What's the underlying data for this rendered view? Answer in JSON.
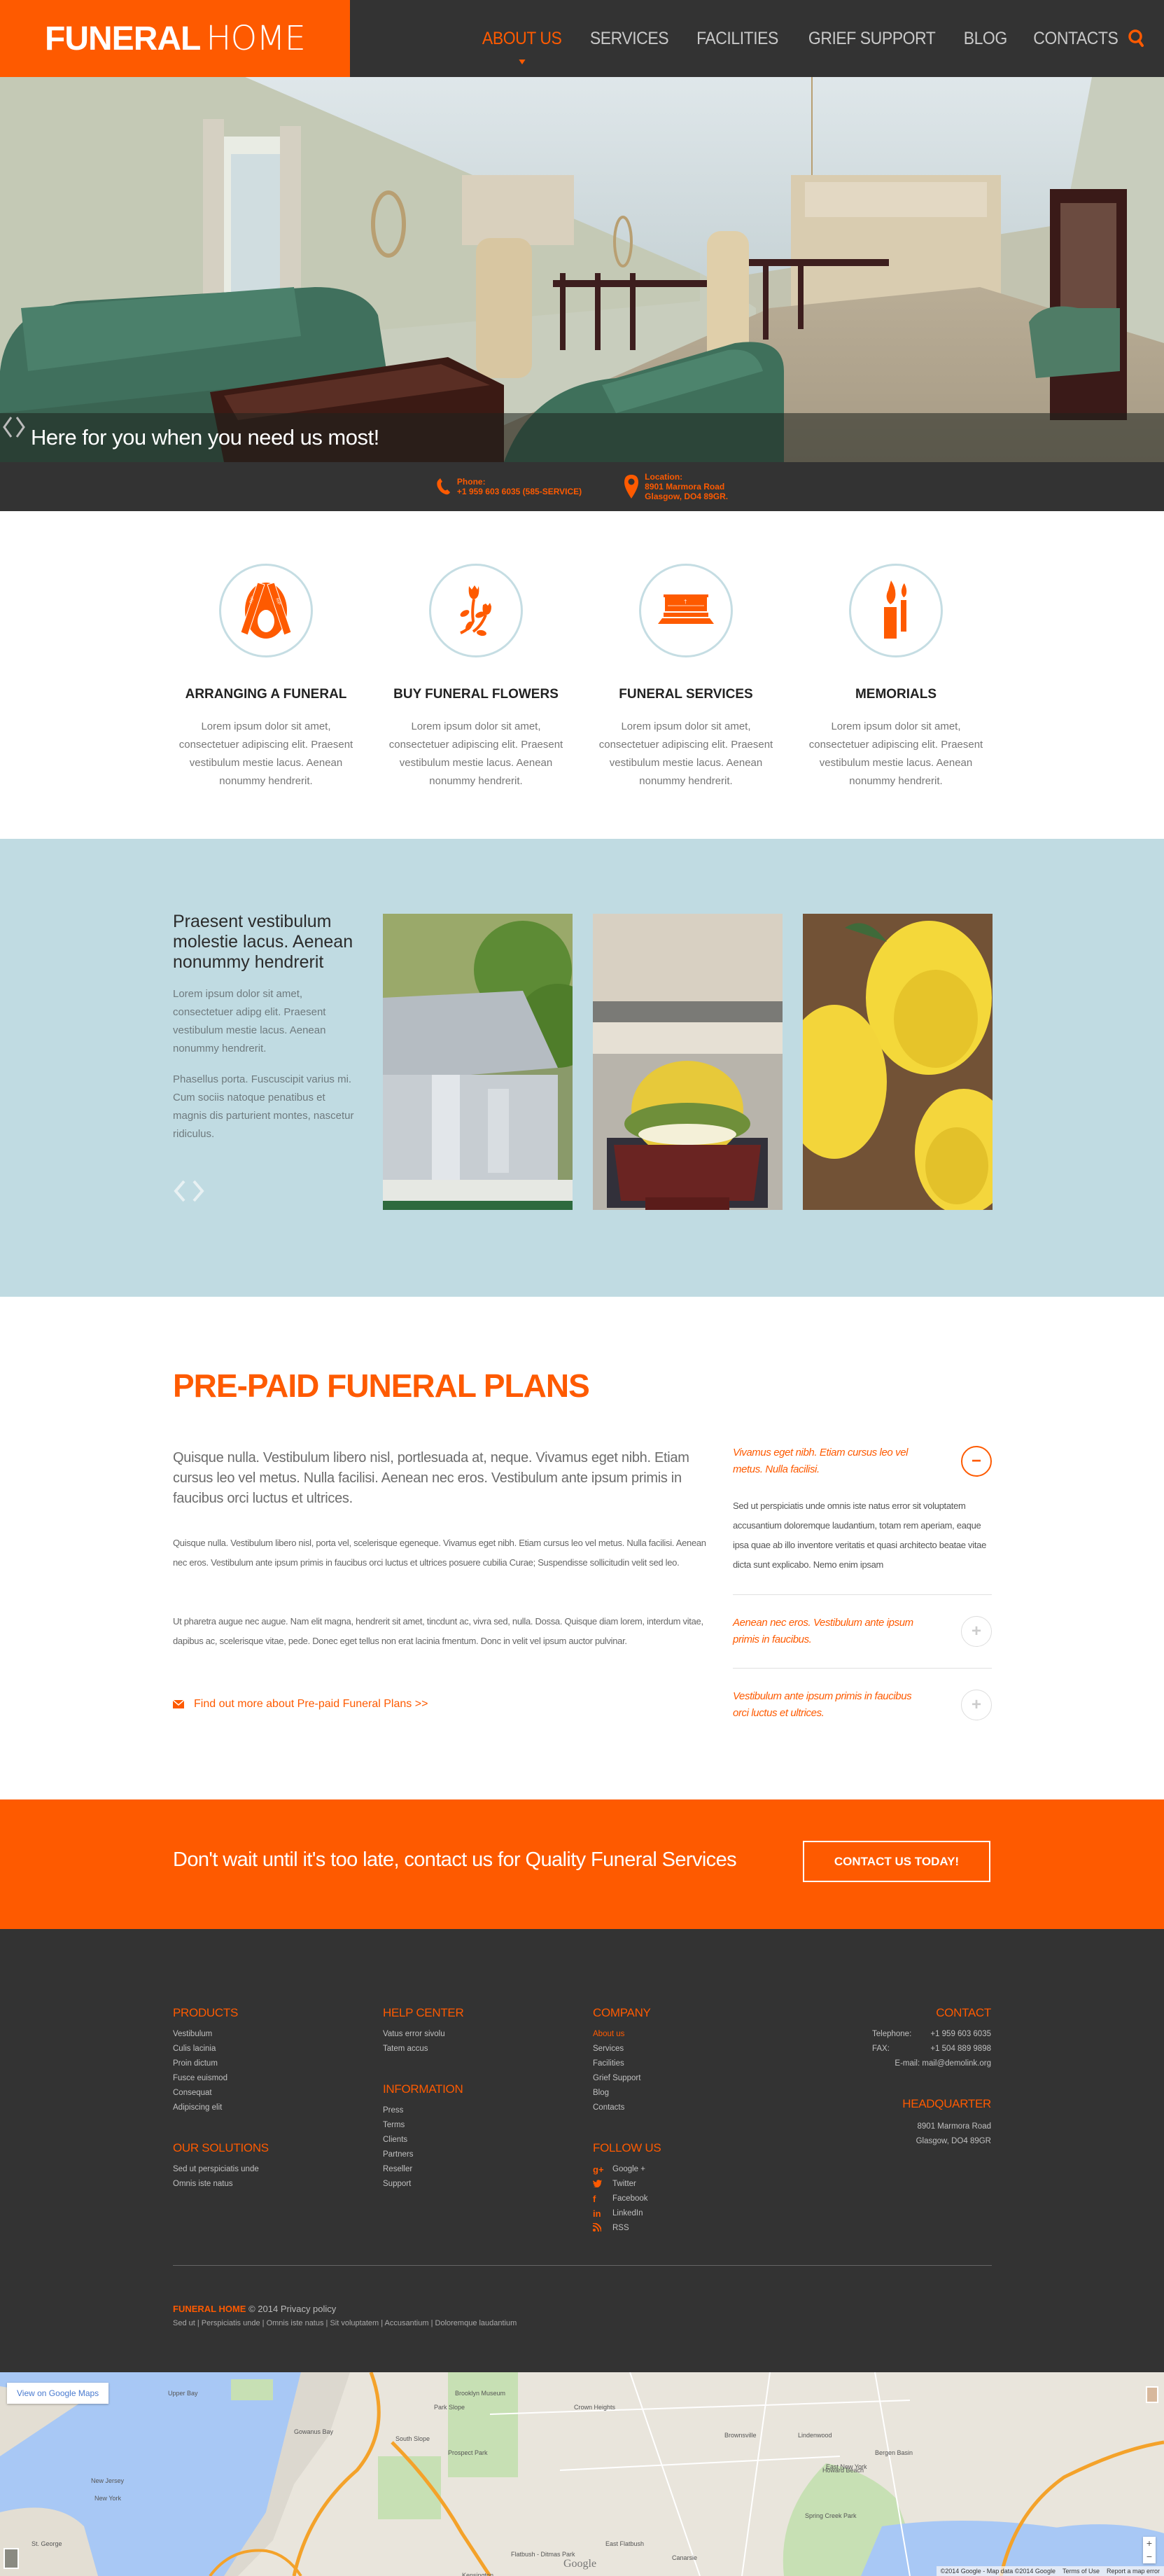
{
  "brand": {
    "bold": "FUNERAL",
    "light": "HOME",
    "accent_color": "#fe5a00",
    "dark_color": "#333333"
  },
  "nav": {
    "items": [
      {
        "label": "ABOUT US",
        "active": true
      },
      {
        "label": "SERVICES",
        "active": false
      },
      {
        "label": "FACILITIES",
        "active": false
      },
      {
        "label": "GRIEF SUPPORT",
        "active": false
      },
      {
        "label": "BLOG",
        "active": false
      },
      {
        "label": "CONTACTS",
        "active": false
      }
    ],
    "search_icon": "search-icon"
  },
  "hero": {
    "caption": "Here for you when you need us most!",
    "arrows_icon": "prev-next-arrows-icon",
    "image_alt": "Funeral home lounge with green sofas and chapel seating"
  },
  "infobar": {
    "phone": {
      "label": "Phone:",
      "value": "+1 959 603 6035 (585-SERVICE)",
      "icon": "phone-icon"
    },
    "location": {
      "label": "Location:",
      "line1": "8901 Marmora Road",
      "line2": "Glasgow, DO4 89GR.",
      "icon": "map-pin-icon"
    }
  },
  "services": [
    {
      "title": "ARRANGING A FUNERAL",
      "text": "Lorem ipsum dolor sit amet, consectetuer adipiscing elit. Praesent vestibulum mestie lacus. Aenean nonummy hendrerit.",
      "icon": "rip-ribbon-icon"
    },
    {
      "title": "BUY FUNERAL FLOWERS",
      "text": "Lorem ipsum dolor sit amet, consectetuer adipiscing elit. Praesent vestibulum mestie lacus. Aenean nonummy hendrerit.",
      "icon": "flower-icon"
    },
    {
      "title": "FUNERAL SERVICES",
      "text": "Lorem ipsum dolor sit amet, consectetuer adipiscing elit. Praesent vestibulum mestie lacus. Aenean nonummy hendrerit.",
      "icon": "coffin-icon"
    },
    {
      "title": "MEMORIALS",
      "text": "Lorem ipsum dolor sit amet, consectetuer adipiscing elit. Praesent vestibulum mestie lacus. Aenean nonummy hendrerit.",
      "icon": "candles-icon"
    }
  ],
  "gallery": {
    "heading": "Praesent vestibulum molestie lacus. Aenean nonummy hendrerit",
    "para1": "Lorem ipsum dolor sit amet, consectetuer adipg elit. Praesent vestibulum mestie lacus. Aenean nonummy hendrerit.",
    "para2": "Phasellus porta. Fuscuscipit varius mi. Cum sociis natoque penatibus et magnis dis parturient montes, nascetur ridiculus.",
    "images": [
      "Silver casket at graveside",
      "Wooden coffin with flowers in hearse",
      "Yellow roses on wood"
    ]
  },
  "prepaid": {
    "title": "PRE-PAID FUNERAL PLANS",
    "lead": "Quisque nulla. Vestibulum libero nisl, portlesuada at, neque. Vivamus eget nibh. Etiam cursus leo vel metus. Nulla facilisi. Aenean nec eros. Vestibulum ante ipsum primis in faucibus orci luctus et ultrices.",
    "para1": "Quisque nulla. Vestibulum libero nisl, porta vel, scelerisque egeneque. Vivamus eget nibh. Etiam cursus leo vel metus. Nulla facilisi. Aenean nec eros. Vestibulum ante ipsum primis in faucibus orci luctus et ultrices posuere cubilia Curae; Suspendisse sollicitudin velit sed leo.",
    "para2": "Ut pharetra augue nec augue. Nam elit magna, hendrerit sit amet, tincdunt ac, vivra sed, nulla. Dossa. Quisque diam lorem, interdum vitae, dapibus ac, scelerisque vitae, pede. Donec eget tellus non erat lacinia fmentum. Donc in velit vel ipsum auctor pulvinar.",
    "link": "Find out more about Pre-paid Funeral Plans >>",
    "accordion": [
      {
        "title": "Vivamus eget nibh. Etiam cursus leo vel metus. Nulla facilisi.",
        "open": true,
        "toggle": "−",
        "body": "Sed ut perspiciatis unde omnis iste natus error sit voluptatem accusantium doloremque laudantium, totam rem aperiam, eaque ipsa quae ab illo inventore veritatis et quasi architecto beatae vitae dicta sunt explicabo. Nemo enim ipsam"
      },
      {
        "title": "Aenean nec eros. Vestibulum ante ipsum primis in faucibus.",
        "open": false,
        "toggle": "+"
      },
      {
        "title": "Vestibulum ante ipsum primis in faucibus orci luctus et ultrices.",
        "open": false,
        "toggle": "+"
      }
    ]
  },
  "cta": {
    "text": "Don't wait until it's too late, contact us for Quality Funeral Services",
    "button": "CONTACT US TODAY!"
  },
  "footer": {
    "products": {
      "heading": "PRODUCTS",
      "items": [
        "Vestibulum",
        "Culis lacinia",
        "Proin dictum",
        "Fusce euismod",
        "Consequat",
        "Adipiscing elit"
      ]
    },
    "solutions": {
      "heading": "OUR SOLUTIONS",
      "items": [
        "Sed ut perspiciatis unde",
        "Omnis iste natus"
      ]
    },
    "help": {
      "heading": "HELP CENTER",
      "items": [
        "Vatus error sivolu",
        "Tatem accus"
      ]
    },
    "information": {
      "heading": "INFORMATION",
      "items": [
        "Press",
        "Terms",
        "Clients",
        "Partners",
        "Reseller",
        "Support"
      ]
    },
    "company": {
      "heading": "COMPANY",
      "items": [
        "About us",
        "Services",
        "Facilities",
        "Grief Support",
        "Blog",
        "Contacts"
      ],
      "selected": "About us"
    },
    "follow": {
      "heading": "FOLLOW US",
      "items": [
        {
          "label": "Google +",
          "icon": "google-plus-icon",
          "glyph": "g+"
        },
        {
          "label": "Twitter",
          "icon": "twitter-icon",
          "glyph": "🐦"
        },
        {
          "label": "Facebook",
          "icon": "facebook-icon",
          "glyph": "f"
        },
        {
          "label": "LinkedIn",
          "icon": "linkedin-icon",
          "glyph": "in"
        },
        {
          "label": "RSS",
          "icon": "rss-icon",
          "glyph": "◝"
        }
      ]
    },
    "contact": {
      "heading": "CONTACT",
      "telephone_label": "Telephone:",
      "telephone": "+1 959 603 6035",
      "fax_label": "FAX:",
      "fax": "+1 504 889 9898",
      "email_label": "E-mail:",
      "email": "mail@demolink.org"
    },
    "headquarter": {
      "heading": "HEADQUARTER",
      "line1": "8901 Marmora Road",
      "line2": "Glasgow, DO4 89GR"
    },
    "copyright": {
      "brand": "FUNERAL HOME",
      "text": "© 2014 Privacy policy"
    },
    "bottom_links": [
      "Sed ut",
      "Perspiciatis unde",
      "Omnis iste natus",
      "Sit voluptatem",
      "Accusantium",
      "Doloremque laudantium"
    ]
  },
  "map": {
    "view_button": "View on Google Maps",
    "attribution": "©2014 Google - Map data ©2014 Google",
    "terms": "Terms of Use",
    "report": "Report a map error",
    "zoom_in": "+",
    "zoom_out": "−",
    "logo": "Google",
    "labels": [
      "Upper Bay",
      "Gowanus Bay",
      "New Jersey",
      "New York",
      "St. George",
      "Park Slope",
      "South Slope",
      "Prospect Park",
      "Brooklyn Museum",
      "Crown Heights",
      "Brownsville",
      "East New York",
      "Spring Creek Park",
      "Howard Beach",
      "Lindenwood",
      "Canarsie",
      "East Flatbush",
      "Kensington",
      "Flatbush - Ditmas Park",
      "Bergen Basin"
    ]
  }
}
